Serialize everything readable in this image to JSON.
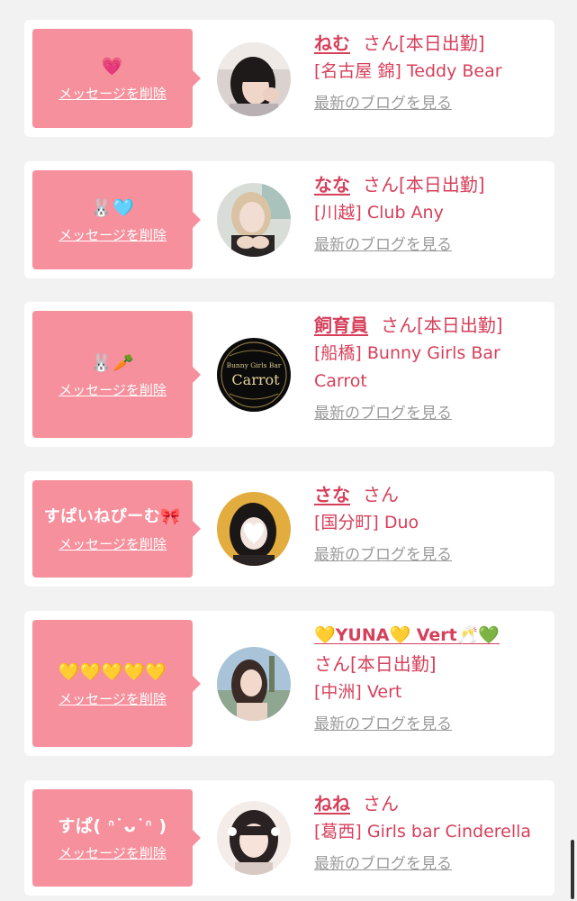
{
  "colors": {
    "accent": "#d6405b",
    "bubble": "#f6909c",
    "muted": "#9a9a9a",
    "page_bg": "#f2f2f2"
  },
  "common": {
    "delete_label": "メッセージを削除",
    "blog_label": "最新のブログを見る",
    "honorific": "さん"
  },
  "entries": [
    {
      "message": "💗",
      "name": "ねむ",
      "status": "[本日出勤]",
      "shop": "[名古屋 錦] Teddy Bear",
      "avatar": "photo-dark-hair"
    },
    {
      "message": "🐰🩵",
      "name": "なな",
      "status": "[本日出勤]",
      "shop": "[川越] Club Any",
      "avatar": "photo-blonde"
    },
    {
      "message": "🐰🥕",
      "name": "飼育員",
      "status": "[本日出勤]",
      "shop": "[船橋] Bunny Girls Bar Carrot",
      "avatar": "logo-carrot",
      "logo_top": "Bunny Girls Bar",
      "logo_main": "Carrot"
    },
    {
      "message": "すぱいねぴーむ🎀",
      "name": "さな",
      "status": "",
      "shop": "[国分町] Duo",
      "avatar": "photo-heart-face"
    },
    {
      "message": "💛💛💛💛💛",
      "name": "💛YUNA💛 Vert🥂💚",
      "status": "[本日出勤]",
      "shop": "[中洲] Vert",
      "avatar": "photo-outdoor"
    },
    {
      "message": "すぱ( ᐢ˙ᴗ˙ᐢ )",
      "name": "ねね",
      "status": "",
      "shop": "[葛西] Girls bar Cinderella",
      "avatar": "photo-twin"
    }
  ]
}
